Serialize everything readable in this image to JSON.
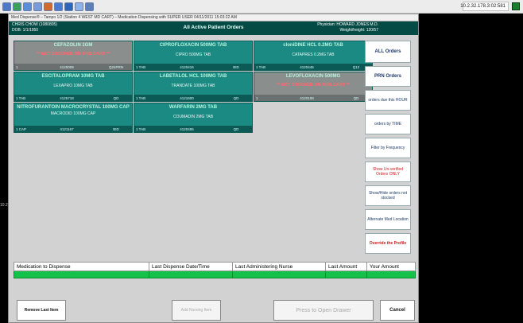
{
  "window_title": "Med Dispense® – Tampo 1/2 (Station 4 WEST MD CART) – Medication Dispensing with SUPER USER 04/11/2011 15:03:22 AM",
  "taskbar": {
    "ip": "10.2.32.178.3:02:581",
    "left_edge": "10.2"
  },
  "header": {
    "patient_name": "CHRIS CHOW (1080805)",
    "dob": "DOB: 1/1/1950",
    "view_title": "All Active Patient Orders",
    "physician": "Physician: HOWARD JONES M.D.",
    "weight": "Weight/height: 120/57"
  },
  "tiles": [
    {
      "name": "CEFAZOLIN 1GM",
      "warning": "** NOT STOCKED ON THIS CART **",
      "desc": "",
      "qty": "1",
      "id": "4120009",
      "freq": "Q24PRN",
      "color": "grey"
    },
    {
      "name": "CIPROFLOXACIN 500MG TAB",
      "warning": "",
      "desc": "CIPRO 500MG TAB",
      "qty": "1 TAB",
      "id": "4120416",
      "freq": "BID",
      "color": "teal"
    },
    {
      "name": "cloniDINE HCL 0.2MG TAB",
      "warning": "",
      "desc": "CATAPRES 0.2MG TAB",
      "qty": "1 TAB",
      "id": "4120446",
      "freq": "Q12",
      "color": "teal"
    },
    {
      "name": "ESCITALOPRAM 10MG TAB",
      "warning": "",
      "desc": "LEXAPRO 10MG TAB",
      "qty": "1 TAB",
      "id": "4125718",
      "freq": "QD",
      "color": "teal"
    },
    {
      "name": "LABETALOL HCL 100MG TAB",
      "warning": "",
      "desc": "TRANDATE 100MG TAB",
      "qty": "1 TAB",
      "id": "4121600",
      "freq": "QD",
      "color": "teal"
    },
    {
      "name": "LEVOFLOXACIN 500MG",
      "warning": "** NOT STOCKED ON THIS CART **",
      "desc": "",
      "qty": "1",
      "id": "4120108",
      "freq": "QD",
      "color": "grey"
    },
    {
      "name": "NITROFURANTOIN MACROCRYSTAL 100MG CAP",
      "warning": "",
      "desc": "MACRODID 100MG CAP",
      "qty": "1 CAP",
      "id": "4121167",
      "freq": "BID",
      "color": "teal"
    },
    {
      "name": "WARFARIN 2MG TAB",
      "warning": "",
      "desc": "COUMADIN 2MG TAB",
      "qty": "1 TAB",
      "id": "4120495",
      "freq": "QD",
      "color": "teal"
    }
  ],
  "sidebar": [
    {
      "label": "ALL Orders",
      "style": "bold"
    },
    {
      "label": "PRN Orders",
      "style": "bold"
    },
    {
      "label": "orders due this HOUR",
      "style": ""
    },
    {
      "label": "orders by TIME",
      "style": ""
    },
    {
      "label": "Filter by Frequency",
      "style": ""
    },
    {
      "label": "Show Un-verified Orders ONLY",
      "style": "red"
    },
    {
      "label": "Show/Hide orders not stocked",
      "style": ""
    },
    {
      "label": "Alternate Med Location",
      "style": ""
    },
    {
      "label": "Override the Profile",
      "style": "red"
    }
  ],
  "dispense_table": {
    "columns": [
      "Medication to Dispense",
      "Last Dispense Date/Time",
      "Last Administering Nurse",
      "Last Amount",
      "Your Amount"
    ]
  },
  "buttons": {
    "remove": "Remove Last Item",
    "add_nursing": "Add Nursing Item",
    "open_drawer": "Press to Open Drawer",
    "cancel": "Cancel"
  }
}
